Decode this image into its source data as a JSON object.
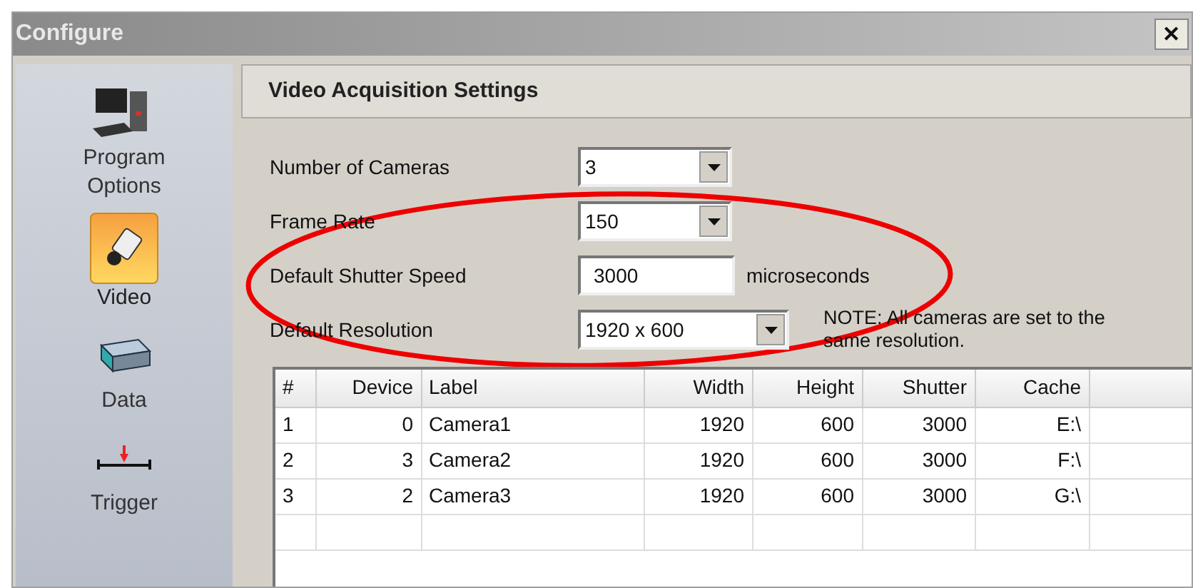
{
  "window": {
    "title": "Configure",
    "close": "✕"
  },
  "sidebar": {
    "items": [
      {
        "label": "Program Options",
        "kind": "computer",
        "selected": false
      },
      {
        "label": "Video",
        "kind": "camera",
        "selected": true
      },
      {
        "label": "Data",
        "kind": "drive",
        "selected": false
      },
      {
        "label": "Trigger",
        "kind": "trigger",
        "selected": false
      }
    ]
  },
  "panel": {
    "title": "Video Acquisition Settings"
  },
  "form": [
    {
      "label": "Number of Cameras",
      "kind": "dropdown",
      "value": "3"
    },
    {
      "label": "Frame Rate",
      "kind": "dropdown",
      "value": "150"
    },
    {
      "label": "Default Shutter Speed",
      "kind": "text",
      "value": "3000",
      "unit": "microseconds"
    },
    {
      "label": "Default Resolution",
      "kind": "dropdown",
      "value": "1920 x 600",
      "note": "NOTE: All cameras are set to the same resolution."
    }
  ],
  "table": {
    "columns": [
      {
        "label": "#",
        "right_aligned": false
      },
      {
        "label": "Device",
        "right_aligned": true
      },
      {
        "label": "Label",
        "right_aligned": false
      },
      {
        "label": "Width",
        "right_aligned": true
      },
      {
        "label": "Height",
        "right_aligned": true
      },
      {
        "label": "Shutter",
        "right_aligned": true
      },
      {
        "label": "Cache",
        "right_aligned": true
      }
    ],
    "rows": [
      [
        "1",
        "0",
        "Camera1",
        "1920",
        "600",
        "3000",
        "E:\\"
      ],
      [
        "2",
        "3",
        "Camera2",
        "1920",
        "600",
        "3000",
        "F:\\"
      ],
      [
        "3",
        "2",
        "Camera3",
        "1920",
        "600",
        "3000",
        "G:\\"
      ]
    ]
  },
  "annotation": {
    "kind": "ellipse"
  }
}
